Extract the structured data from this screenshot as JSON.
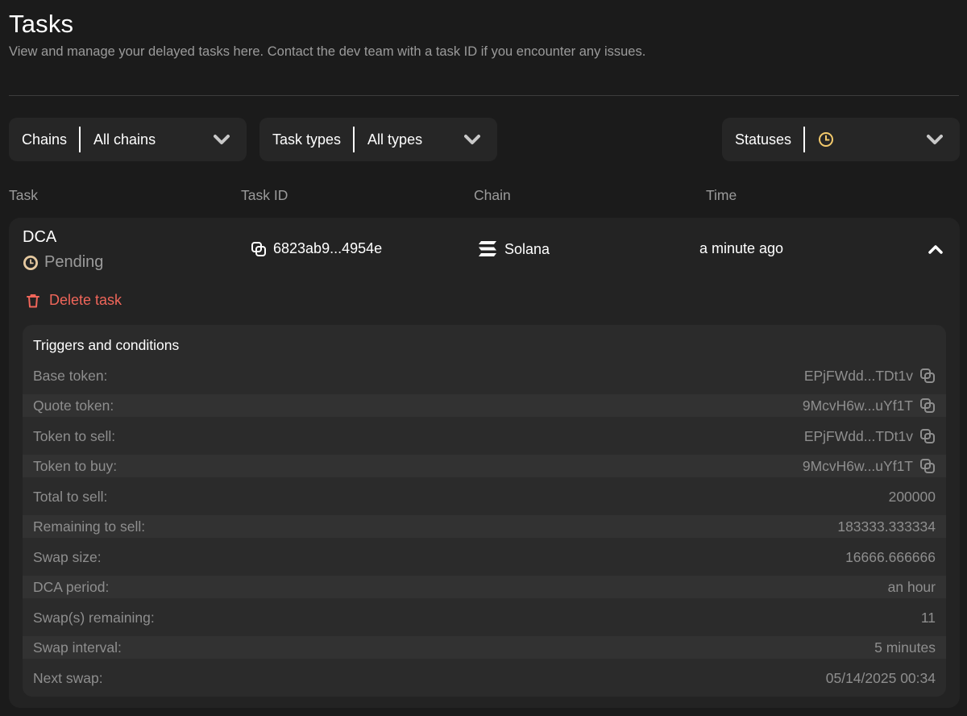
{
  "header": {
    "title": "Tasks",
    "subtitle": "View and manage your delayed tasks here. Contact the dev team with a task ID if you encounter any issues."
  },
  "filters": {
    "chains": {
      "label": "Chains",
      "value": "All chains"
    },
    "task_types": {
      "label": "Task types",
      "value": "All types"
    },
    "statuses": {
      "label": "Statuses",
      "value_icon": "clock-icon"
    }
  },
  "columns": {
    "task": "Task",
    "task_id": "Task ID",
    "chain": "Chain",
    "time": "Time"
  },
  "task": {
    "name": "DCA",
    "status": "Pending",
    "status_icon": "clock-icon",
    "id": "6823ab9...4954e",
    "chain": "Solana",
    "time": "a minute ago",
    "delete_label": "Delete task",
    "triggers_title": "Triggers and conditions",
    "rows": [
      {
        "label": "Base token:",
        "value": "EPjFWdd...TDt1v",
        "copyable": true
      },
      {
        "label": "Quote token:",
        "value": "9McvH6w...uYf1T",
        "copyable": true
      },
      {
        "label": "Token to sell:",
        "value": "EPjFWdd...TDt1v",
        "copyable": true
      },
      {
        "label": "Token to buy:",
        "value": "9McvH6w...uYf1T",
        "copyable": true
      },
      {
        "label": "Total to sell:",
        "value": "200000",
        "copyable": false
      },
      {
        "label": "Remaining to sell:",
        "value": "183333.333334",
        "copyable": false
      },
      {
        "label": "Swap size:",
        "value": "16666.666666",
        "copyable": false
      },
      {
        "label": "DCA period:",
        "value": "an hour",
        "copyable": false
      },
      {
        "label": "Swap(s) remaining:",
        "value": "11",
        "copyable": false
      },
      {
        "label": "Swap interval:",
        "value": "5 minutes",
        "copyable": false
      },
      {
        "label": "Next swap:",
        "value": "05/14/2025 00:34",
        "copyable": false
      }
    ]
  },
  "colors": {
    "background": "#1b1b1b",
    "card": "#232323",
    "accent_pending": "#f3c96b",
    "danger": "#f0665a"
  }
}
